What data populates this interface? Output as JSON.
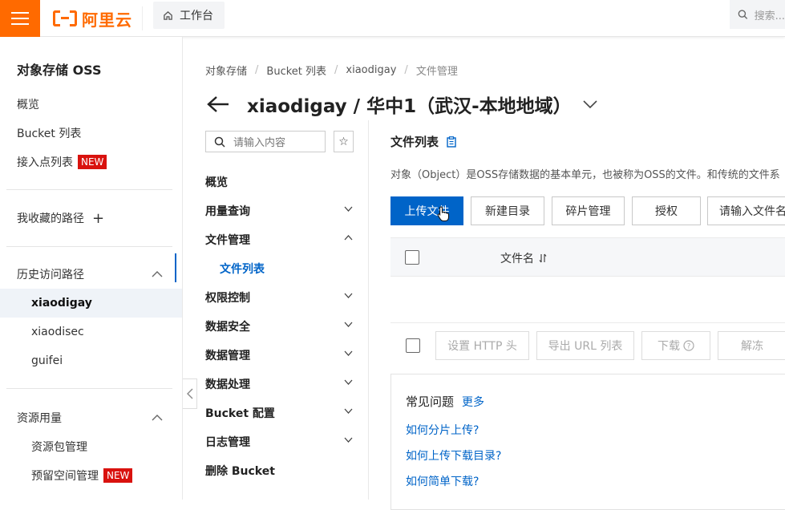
{
  "topbar": {
    "logo_text": "阿里云",
    "workbench_label": "工作台",
    "search_placeholder": "搜索..."
  },
  "sidebar": {
    "title": "对象存储 OSS",
    "items_top": [
      {
        "label": "概览"
      },
      {
        "label": "Bucket 列表"
      },
      {
        "label": "接入点列表",
        "badge": "NEW"
      }
    ],
    "favorites_label": "我收藏的路径",
    "history_label": "历史访问路径",
    "history_items": [
      "xiaodigay",
      "xiaodisec",
      "guifei"
    ],
    "resource_label": "资源用量",
    "resource_items": [
      {
        "label": "资源包管理"
      },
      {
        "label": "预留空间管理",
        "badge": "NEW"
      }
    ]
  },
  "breadcrumb": [
    "对象存储",
    "Bucket 列表",
    "xiaodigay",
    "文件管理"
  ],
  "header": {
    "title": "xiaodigay / 华中1（武汉-本地地域）"
  },
  "subnav": {
    "search_placeholder": "请输入内容",
    "items": [
      {
        "label": "概览",
        "chevron": ""
      },
      {
        "label": "用量查询",
        "chevron": "down"
      },
      {
        "label": "文件管理",
        "chevron": "up"
      },
      {
        "label": "文件列表",
        "chevron": "",
        "sub": true
      },
      {
        "label": "权限控制",
        "chevron": "down"
      },
      {
        "label": "数据安全",
        "chevron": "down"
      },
      {
        "label": "数据管理",
        "chevron": "down"
      },
      {
        "label": "数据处理",
        "chevron": "down"
      },
      {
        "label": "Bucket 配置",
        "chevron": "down"
      },
      {
        "label": "日志管理",
        "chevron": "down"
      },
      {
        "label": "删除 Bucket",
        "chevron": ""
      }
    ]
  },
  "main": {
    "title": "文件列表",
    "description": "对象（Object）是OSS存储数据的基本单元，也被称为OSS的文件。和传统的文件系",
    "buttons": {
      "upload": "上传文件",
      "new_dir": "新建目录",
      "fragments": "碎片管理",
      "authorize": "授权",
      "search_placeholder": "请输入文件名"
    },
    "table": {
      "col_name": "文件名"
    },
    "bulk_actions": {
      "http_header": "设置 HTTP 头",
      "export_url": "导出 URL 列表",
      "download": "下载",
      "unfreeze": "解冻"
    },
    "faq": {
      "title": "常见问题",
      "more": "更多",
      "links": [
        "如何分片上传?",
        "如何上传下载目录?",
        "如何简单下载?"
      ]
    }
  },
  "colors": {
    "brand": "#ff6a00",
    "primary": "#0064c8",
    "badge": "#d9120e"
  }
}
